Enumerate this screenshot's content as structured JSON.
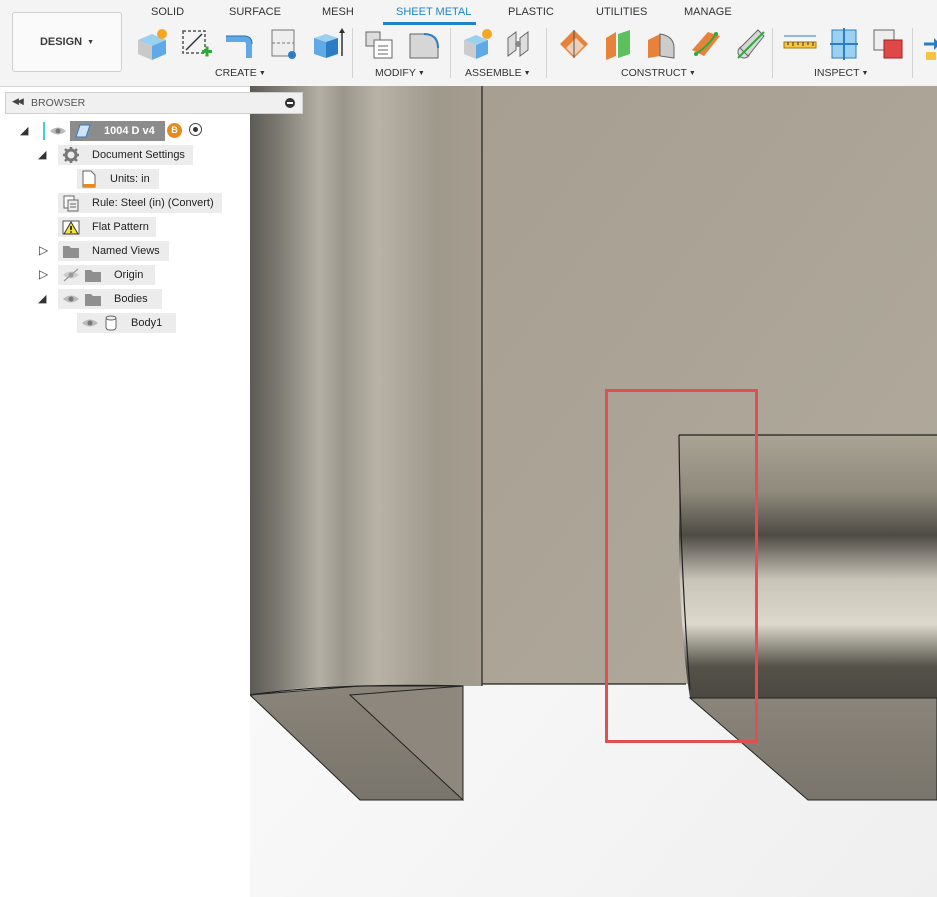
{
  "workspace_button": {
    "label": "DESIGN"
  },
  "tabs": [
    {
      "label": "SOLID"
    },
    {
      "label": "SURFACE"
    },
    {
      "label": "MESH"
    },
    {
      "label": "SHEET METAL"
    },
    {
      "label": "PLASTIC"
    },
    {
      "label": "UTILITIES"
    },
    {
      "label": "MANAGE"
    }
  ],
  "active_tab": "SHEET METAL",
  "groups": [
    {
      "label": "CREATE"
    },
    {
      "label": "MODIFY"
    },
    {
      "label": "ASSEMBLE"
    },
    {
      "label": "CONSTRUCT"
    },
    {
      "label": "INSPECT"
    }
  ],
  "browser": {
    "title": "BROWSER",
    "root": {
      "label": "1004 D v4"
    },
    "document_settings": {
      "label": "Document Settings"
    },
    "units": {
      "label": "Units: in"
    },
    "rule": {
      "label": "Rule: Steel (in) (Convert)"
    },
    "flat_pattern": {
      "label": "Flat Pattern"
    },
    "named_views": {
      "label": "Named Views"
    },
    "origin": {
      "label": "Origin"
    },
    "bodies": {
      "label": "Bodies"
    },
    "body1": {
      "label": "Body1"
    }
  },
  "colors": {
    "accent": "#1e86c8",
    "selection_highlight": "#e05050",
    "model_surface": "#a8a193"
  }
}
